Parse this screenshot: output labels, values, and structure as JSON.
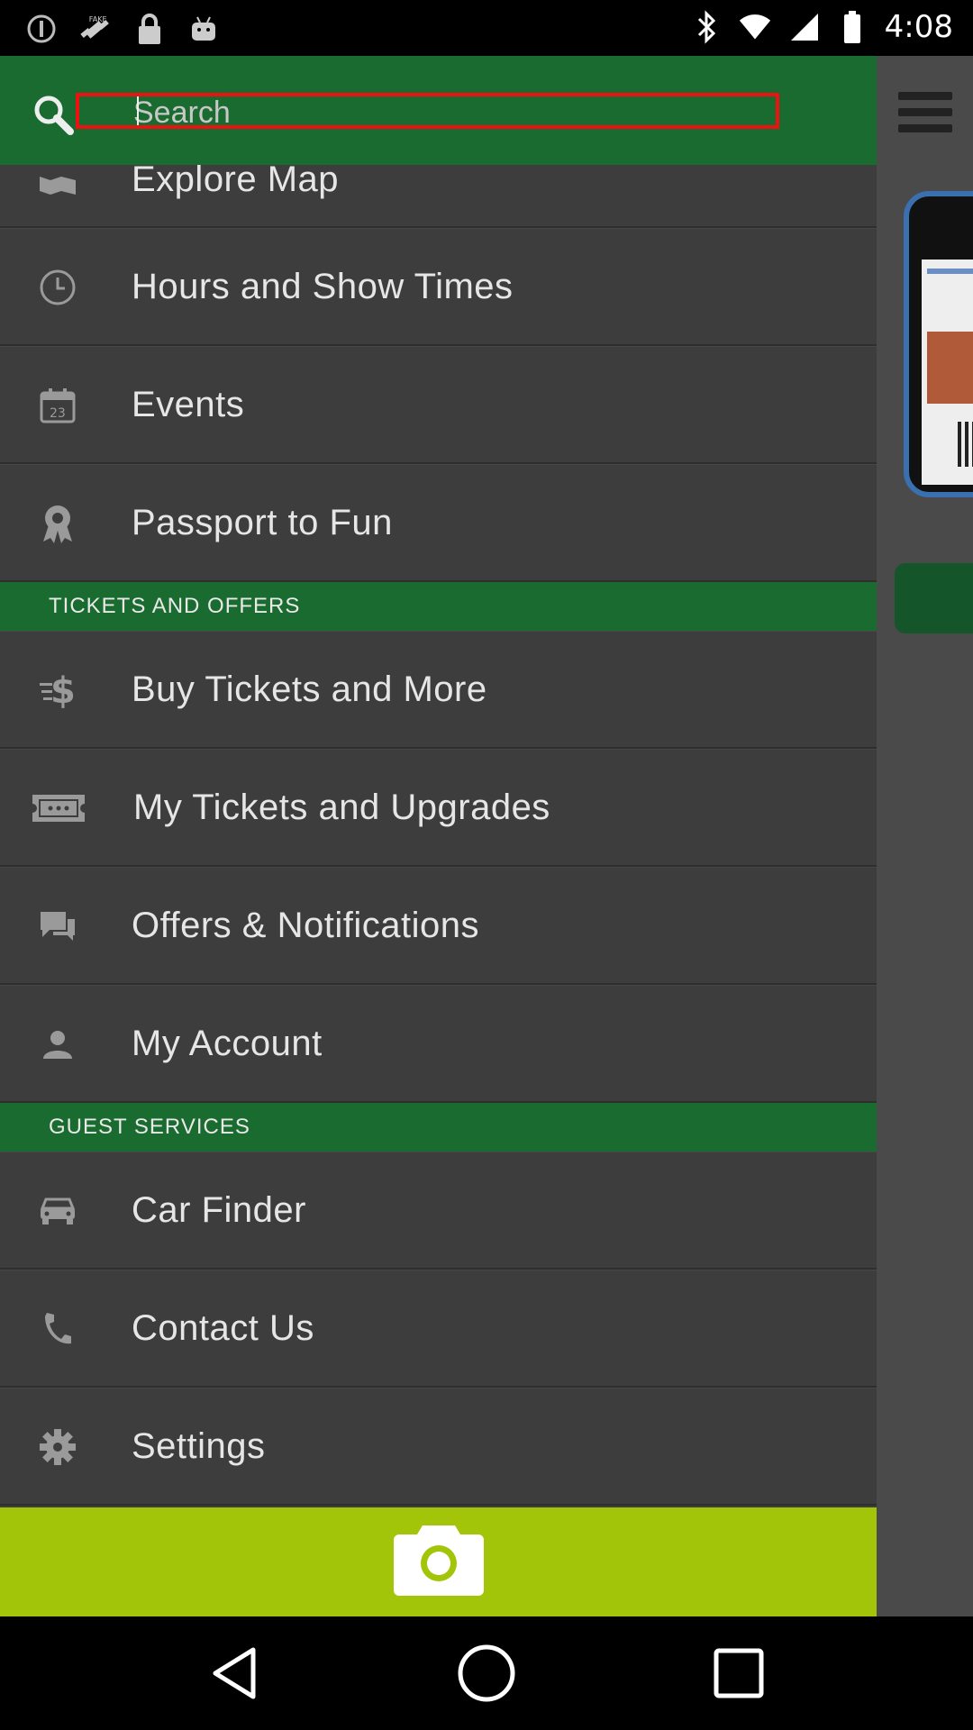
{
  "status_bar": {
    "time": "4:08",
    "icons": [
      "alert-circle-icon",
      "fake-gps-icon",
      "lock-icon",
      "android-icon",
      "bluetooth-icon",
      "wifi-icon",
      "signal-icon",
      "battery-icon"
    ]
  },
  "search": {
    "placeholder": "Search"
  },
  "menu": {
    "items": [
      {
        "label": "Explore Map",
        "icon": "map-icon"
      },
      {
        "label": "Hours and Show Times",
        "icon": "clock-icon"
      },
      {
        "label": "Events",
        "icon": "calendar-icon"
      },
      {
        "label": "Passport to Fun",
        "icon": "award-ribbon-icon"
      }
    ],
    "section_tickets": "TICKETS AND OFFERS",
    "tickets_items": [
      {
        "label": "Buy Tickets and More",
        "icon": "dollar-icon"
      },
      {
        "label": "My Tickets and Upgrades",
        "icon": "ticket-icon"
      },
      {
        "label": "Offers & Notifications",
        "icon": "chat-bubbles-icon"
      },
      {
        "label": "My Account",
        "icon": "person-icon"
      }
    ],
    "section_guest": "GUEST SERVICES",
    "guest_items": [
      {
        "label": "Car Finder",
        "icon": "car-icon"
      },
      {
        "label": "Contact Us",
        "icon": "phone-icon"
      },
      {
        "label": "Settings",
        "icon": "gear-icon"
      }
    ]
  },
  "calendar_day": "23",
  "colors": {
    "header_green": "#1a6b2f",
    "drawer_bg": "#3d3d3d",
    "camera_bar": "#a3c509",
    "search_outline": "#ee1111"
  }
}
